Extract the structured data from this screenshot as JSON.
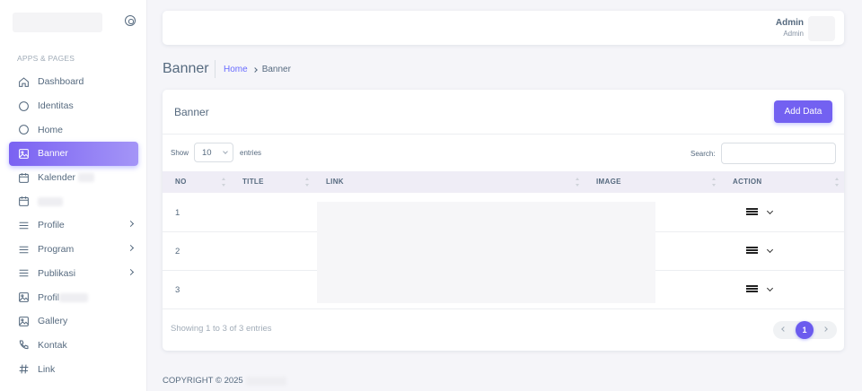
{
  "sidebar": {
    "section_header": "APPS & PAGES",
    "items": [
      {
        "label": "Dashboard",
        "icon": "home-icon"
      },
      {
        "label": "Identitas",
        "icon": "circle-icon"
      },
      {
        "label": "Home",
        "icon": "circle-icon"
      },
      {
        "label": "Banner",
        "icon": "image-icon",
        "active": true
      },
      {
        "label": "Kalender",
        "icon": "calendar-icon"
      },
      {
        "label": "",
        "icon": "calendar-icon"
      },
      {
        "label": "Profile",
        "icon": "menu-icon",
        "has_submenu": true
      },
      {
        "label": "Program",
        "icon": "menu-icon",
        "has_submenu": true
      },
      {
        "label": "Publikasi",
        "icon": "menu-icon",
        "has_submenu": true
      },
      {
        "label": "Profil",
        "icon": "image-icon"
      },
      {
        "label": "Gallery",
        "icon": "image-icon"
      },
      {
        "label": "Kontak",
        "icon": "phone-icon"
      },
      {
        "label": "Link",
        "icon": "hash-icon"
      }
    ]
  },
  "navbar": {
    "user_name": "Admin",
    "user_role": "Admin"
  },
  "page": {
    "title": "Banner",
    "breadcrumb_home": "Home",
    "breadcrumb_current": "Banner"
  },
  "card": {
    "title": "Banner",
    "add_button": "Add Data",
    "show_label": "Show",
    "page_length": "10",
    "entries_label": "entries",
    "search_label": "Search:",
    "search_value": ""
  },
  "table": {
    "columns": [
      "NO",
      "TITLE",
      "LINK",
      "IMAGE",
      "ACTION"
    ],
    "rows": [
      {
        "no": "1",
        "title": "",
        "link": "",
        "image": ""
      },
      {
        "no": "2",
        "title": "",
        "link": "",
        "image": ""
      },
      {
        "no": "3",
        "title": "",
        "link": "",
        "image": ""
      }
    ],
    "info": "Showing 1 to 3 of 3 entries",
    "current_page": "1"
  },
  "footer": {
    "copyright": "COPYRIGHT © 2025"
  },
  "colors": {
    "accent": "#7361f1",
    "active_gradient_start": "#7a62f2",
    "active_gradient_end": "#a495f7",
    "background": "#f5f5f9"
  }
}
